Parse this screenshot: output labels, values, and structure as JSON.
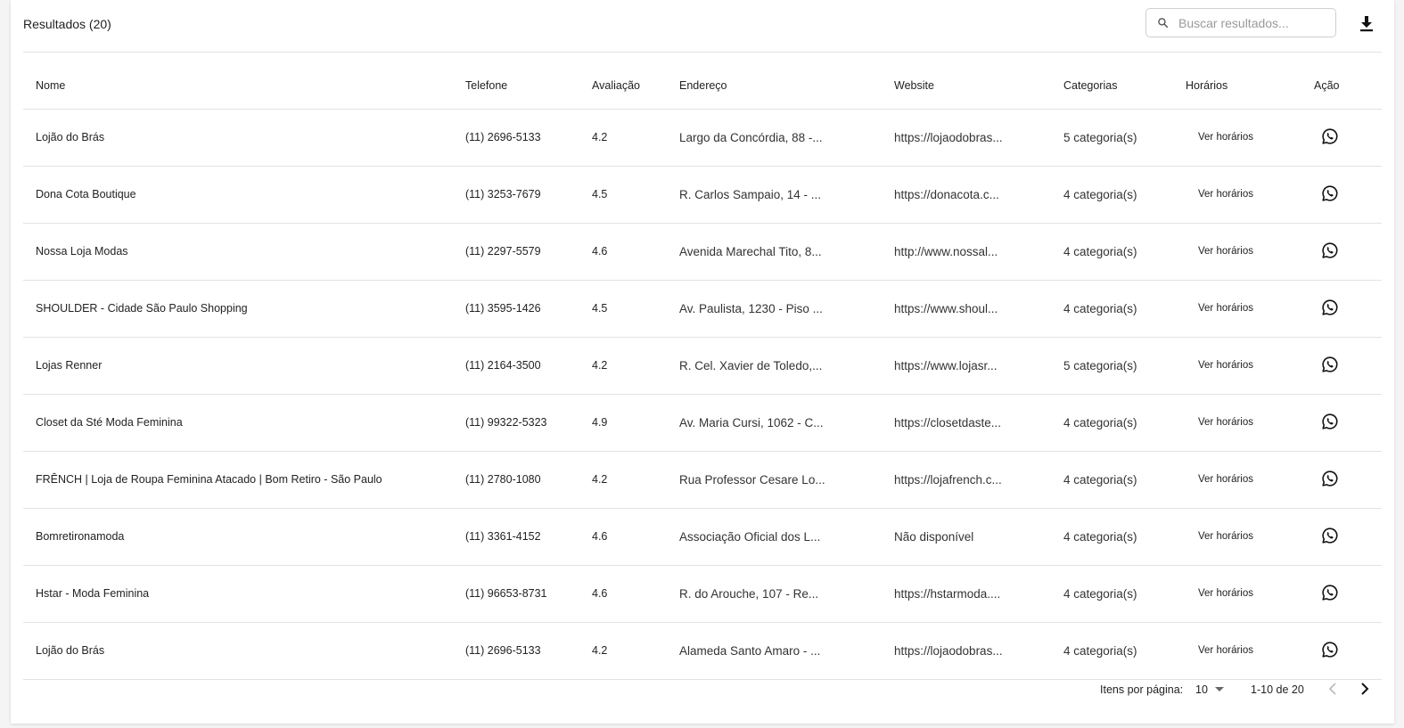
{
  "header": {
    "title": "Resultados (20)",
    "search_placeholder": "Buscar resultados...",
    "search_icon": "search-icon",
    "download_icon": "download-icon"
  },
  "table": {
    "columns": [
      "Nome",
      "Telefone",
      "Avaliação",
      "Endereço",
      "Website",
      "Categorias",
      "Horários",
      "Ação"
    ],
    "rows": [
      {
        "nome": "Lojão do Brás",
        "telefone": "(11) 2696-5133",
        "avaliacao": "4.2",
        "endereco": "Largo da Concórdia, 88 -...",
        "website": "https://lojaodobras...",
        "categorias": "5 categoria(s)",
        "horarios": "Ver horários"
      },
      {
        "nome": "Dona Cota Boutique",
        "telefone": "(11) 3253-7679",
        "avaliacao": "4.5",
        "endereco": "R. Carlos Sampaio, 14 - ...",
        "website": "https://donacota.c...",
        "categorias": "4 categoria(s)",
        "horarios": "Ver horários"
      },
      {
        "nome": "Nossa Loja Modas",
        "telefone": "(11) 2297-5579",
        "avaliacao": "4.6",
        "endereco": "Avenida Marechal Tito, 8...",
        "website": "http://www.nossal...",
        "categorias": "4 categoria(s)",
        "horarios": "Ver horários"
      },
      {
        "nome": "SHOULDER - Cidade São Paulo Shopping",
        "telefone": "(11) 3595-1426",
        "avaliacao": "4.5",
        "endereco": "Av. Paulista, 1230 - Piso ...",
        "website": "https://www.shoul...",
        "categorias": "4 categoria(s)",
        "horarios": "Ver horários"
      },
      {
        "nome": "Lojas Renner",
        "telefone": "(11) 2164-3500",
        "avaliacao": "4.2",
        "endereco": "R. Cel. Xavier de Toledo,...",
        "website": "https://www.lojasr...",
        "categorias": "5 categoria(s)",
        "horarios": "Ver horários"
      },
      {
        "nome": "Closet da Sté Moda Feminina",
        "telefone": "(11) 99322-5323",
        "avaliacao": "4.9",
        "endereco": "Av. Maria Cursi, 1062 - C...",
        "website": "https://closetdaste...",
        "categorias": "4 categoria(s)",
        "horarios": "Ver horários"
      },
      {
        "nome": "FRÊNCH | Loja de Roupa Feminina Atacado | Bom Retiro - São Paulo",
        "telefone": "(11) 2780-1080",
        "avaliacao": "4.2",
        "endereco": "Rua Professor Cesare Lo...",
        "website": "https://lojafrench.c...",
        "categorias": "4 categoria(s)",
        "horarios": "Ver horários"
      },
      {
        "nome": "Bomretironamoda",
        "telefone": "(11) 3361-4152",
        "avaliacao": "4.6",
        "endereco": "Associação Oficial dos L...",
        "website": "Não disponível",
        "categorias": "4 categoria(s)",
        "horarios": "Ver horários"
      },
      {
        "nome": "Hstar - Moda Feminina",
        "telefone": "(11) 96653-8731",
        "avaliacao": "4.6",
        "endereco": "R. do Arouche, 107 - Re...",
        "website": "https://hstarmoda....",
        "categorias": "4 categoria(s)",
        "horarios": "Ver horários"
      },
      {
        "nome": "Lojão do Brás",
        "telefone": "(11) 2696-5133",
        "avaliacao": "4.2",
        "endereco": "Alameda Santo Amaro - ...",
        "website": "https://lojaodobras...",
        "categorias": "4 categoria(s)",
        "horarios": "Ver horários"
      }
    ],
    "action_icon": "whatsapp-icon"
  },
  "pagination": {
    "per_page_label": "Itens por página:",
    "per_page_value": "10",
    "range_label": "1-10 de 20",
    "prev_icon": "chevron-left-icon",
    "next_icon": "chevron-right-icon"
  },
  "colors": {
    "border": "#e3e3e3",
    "text": "#1f1f1f",
    "muted": "#9a9a9a",
    "disabled": "#bdbdbd"
  }
}
